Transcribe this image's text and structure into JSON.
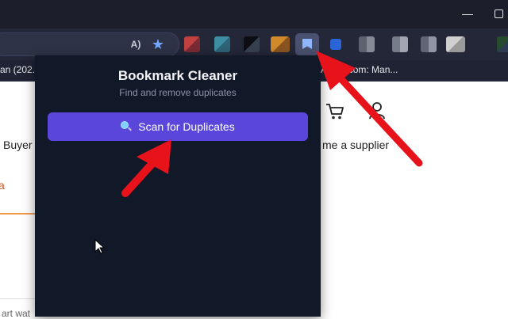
{
  "window": {
    "minimize_glyph": "—"
  },
  "toolbar": {
    "read_aloud_glyph": "A)",
    "favorite_glyph": "★",
    "icons": [
      "read-aloud-icon",
      "favorite-star-icon",
      "extension-icons",
      "bookmark-cleaner-extension-icon"
    ]
  },
  "bookmarks_bar": {
    "left_item": "an (202...",
    "right_item": "A...ba.com: Man..."
  },
  "page": {
    "buyer_text": "Buyer",
    "supplier_text": "me a supplier",
    "fragment_a": "a",
    "bottom_fragment": "art wat",
    "icons": [
      "cart-icon",
      "user-icon"
    ]
  },
  "popup": {
    "title": "Bookmark Cleaner",
    "subtitle": "Find and remove duplicates",
    "scan_button": "Scan for Duplicates",
    "icons": [
      "magnifier-icon"
    ]
  },
  "colors": {
    "popup_bg": "#111827",
    "button_bg": "#5b46dc",
    "arrow": "#e8121b",
    "browser_dark": "#232737"
  }
}
